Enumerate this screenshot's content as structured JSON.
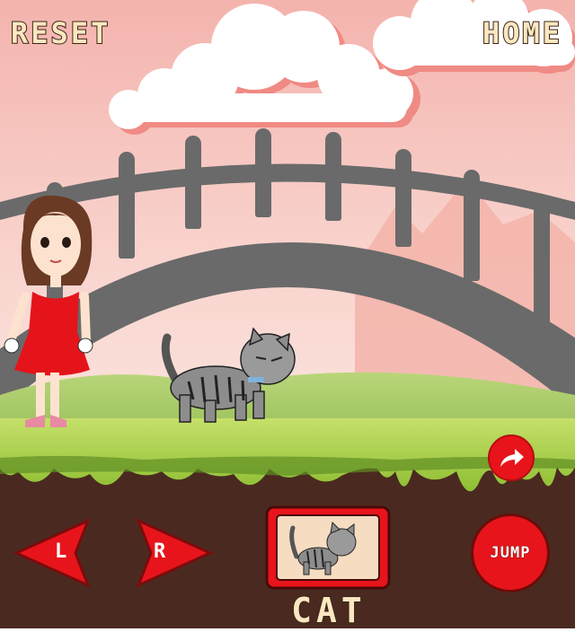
{
  "header": {
    "reset_label": "RESET",
    "home_label": "HOME"
  },
  "controls": {
    "left_label": "L",
    "right_label": "R",
    "jump_label": "JUMP"
  },
  "character": {
    "name": "CAT"
  },
  "icons": {
    "share": "share-arrow-icon"
  },
  "colors": {
    "accent_red": "#e8141b",
    "sky_pink": "#f7c9c4",
    "grass_green": "#a9d24a",
    "soil_brown": "#4a2a20",
    "bridge_gray": "#6a6a6a"
  }
}
